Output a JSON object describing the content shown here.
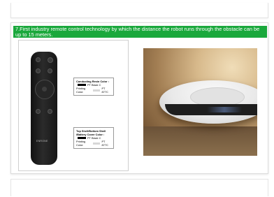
{
  "banner": {
    "text": "7.First industry remote control technology by which the distance the robot runs through the obstacle can be up to 15 meters."
  },
  "remote": {
    "brand_logo": "ENRONE",
    "label_case": {
      "title": "Conducting  Resin Color :",
      "color1": "PT Black C",
      "printing_label": "Printing Color:",
      "color2": "PT 877C"
    },
    "label_shell": {
      "title_line1": "Top  Shell/Bottom Shell",
      "title_line2": "/Battery Cover  Color :",
      "color1": "PT Black C",
      "printing_label": "Printing Color:",
      "color2": "PT 877C"
    }
  },
  "photo": {
    "subject": "robot vacuum cleaner"
  },
  "colors": {
    "banner_bg": "#1aa83c",
    "banner_text": "#ffffff",
    "remote_body": "#1a1a1a"
  }
}
